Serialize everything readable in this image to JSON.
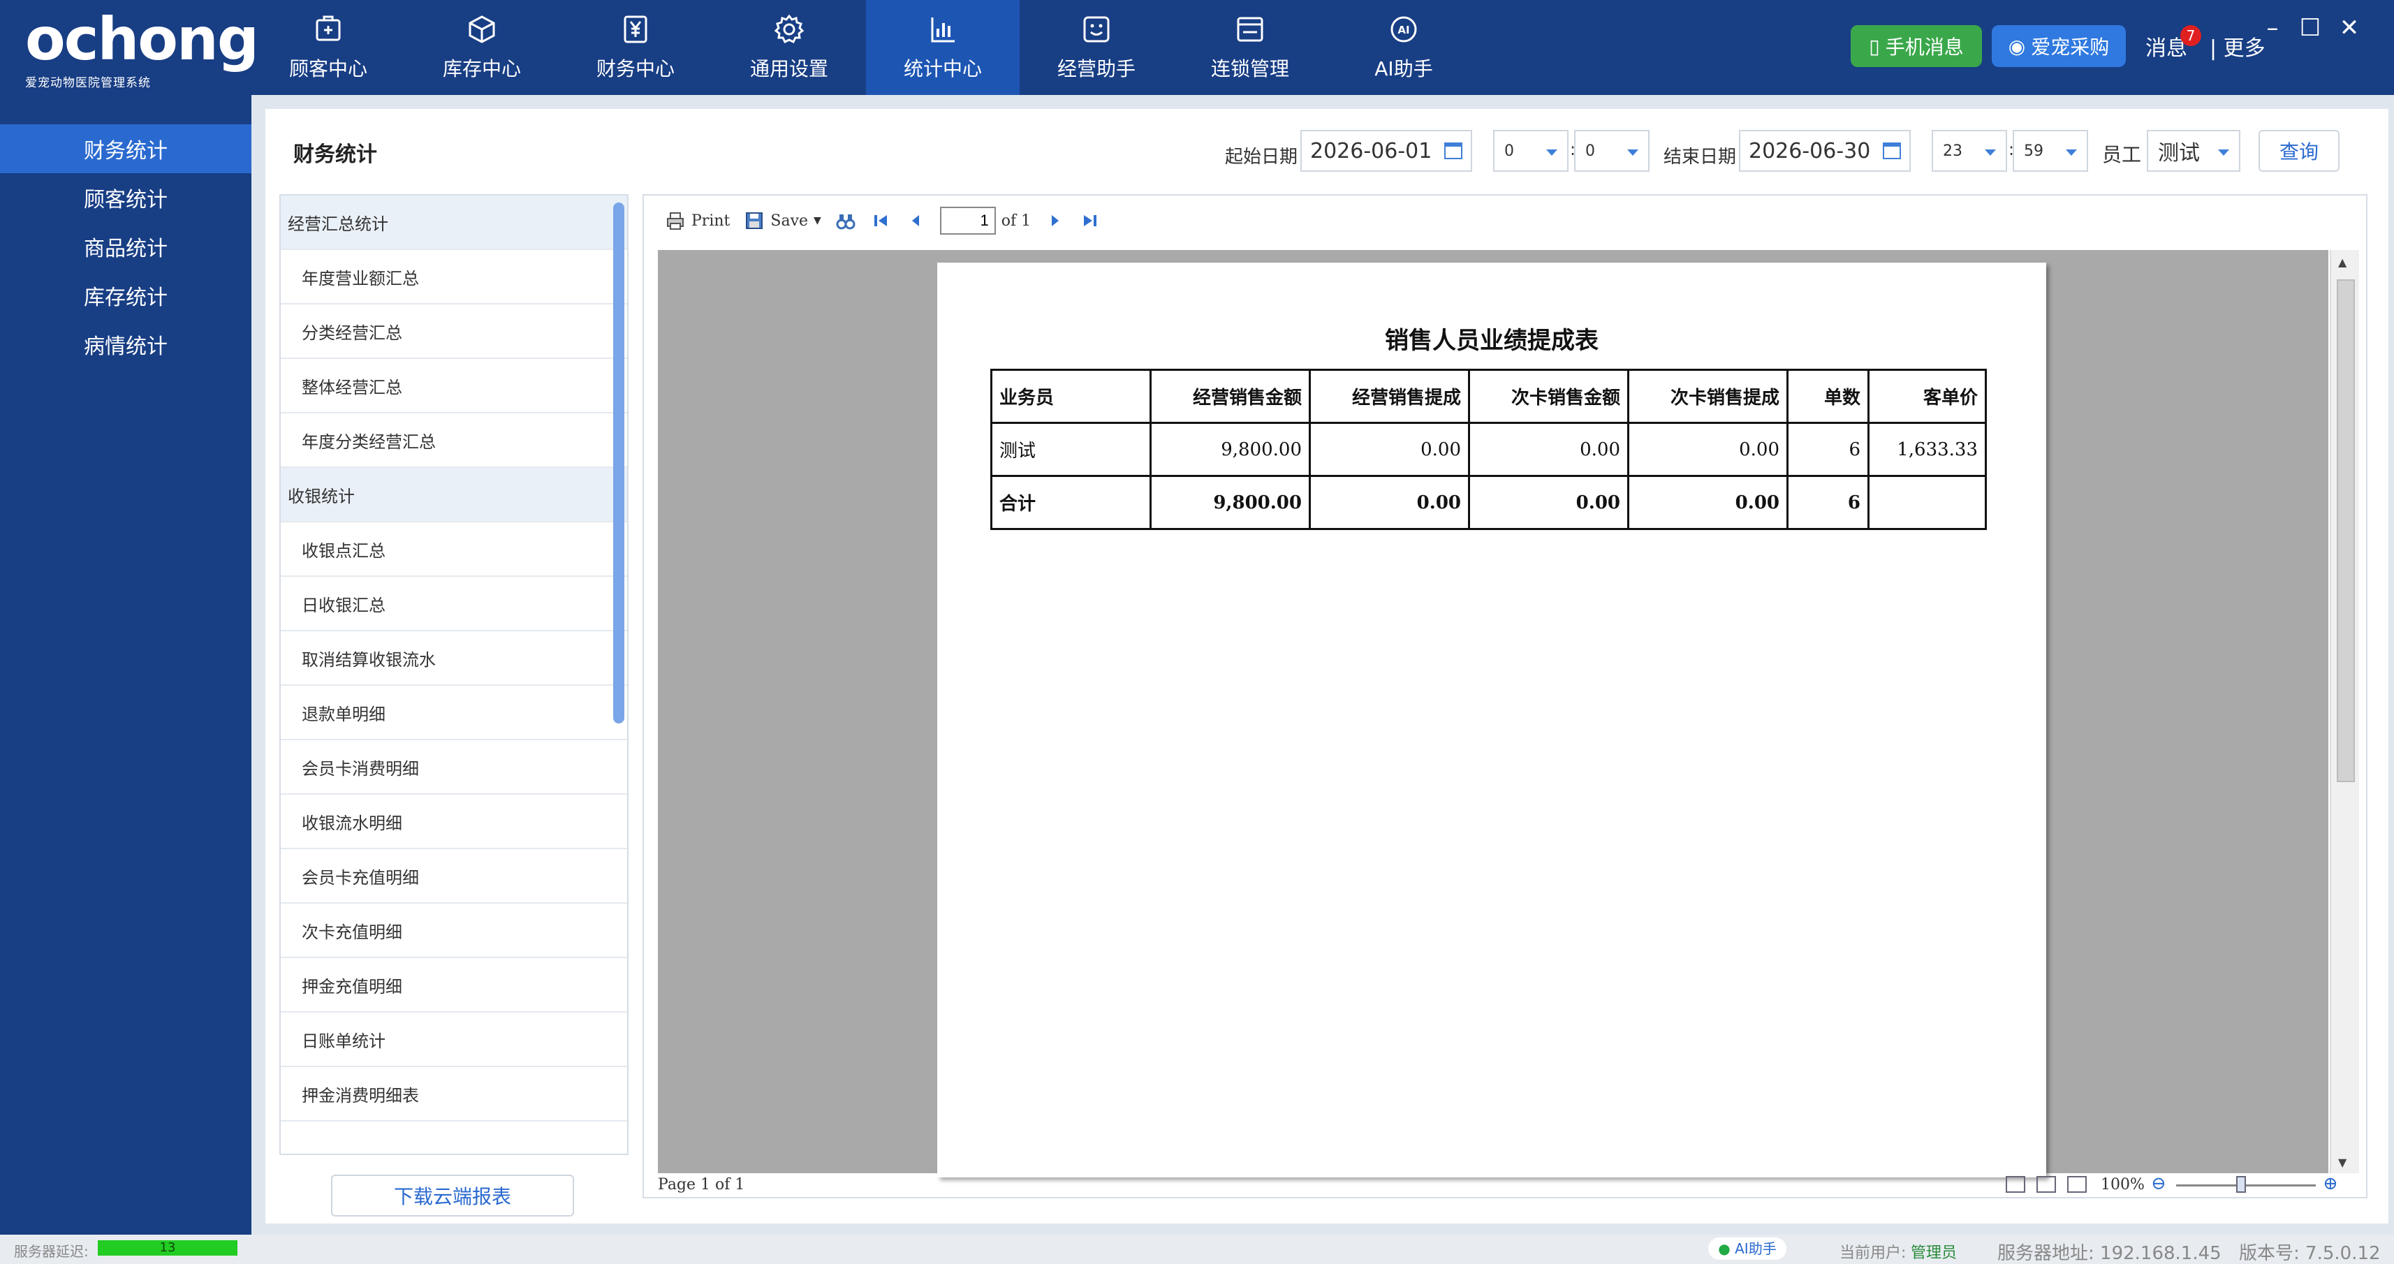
{
  "app": {
    "brand": "ochong",
    "tagline": "爱宠动物医院管理系统"
  },
  "nav": [
    {
      "label": "顾客中心",
      "icon": "customer-icon"
    },
    {
      "label": "库存中心",
      "icon": "box-icon"
    },
    {
      "label": "财务中心",
      "icon": "yen-icon"
    },
    {
      "label": "通用设置",
      "icon": "gear-icon"
    },
    {
      "label": "统计中心",
      "icon": "bar-chart-icon",
      "active": true
    },
    {
      "label": "经营助手",
      "icon": "smile-icon"
    },
    {
      "label": "连锁管理",
      "icon": "window-icon"
    },
    {
      "label": "AI助手",
      "icon": "ai-icon"
    }
  ],
  "top_right": {
    "mobile_msg": "手机消息",
    "purchase": "爱宠采购",
    "messages": "消息",
    "badge": "7",
    "more": "更多"
  },
  "sidebar": [
    {
      "label": "财务统计",
      "active": true
    },
    {
      "label": "顾客统计"
    },
    {
      "label": "商品统计"
    },
    {
      "label": "库存统计"
    },
    {
      "label": "病情统计"
    }
  ],
  "toolbar": {
    "title": "财务统计",
    "start_label": "起始日期",
    "start_date": "2026-06-01",
    "start_hour": "0",
    "start_min": "0",
    "end_label": "结束日期",
    "end_date": "2026-06-30",
    "end_hour": "23",
    "end_min": "59",
    "staff_label": "员工",
    "staff_value": "测试",
    "query": "查询"
  },
  "report_list": [
    {
      "label": "经营汇总统计",
      "group": true
    },
    {
      "label": "年度营业额汇总"
    },
    {
      "label": "分类经营汇总"
    },
    {
      "label": "整体经营汇总"
    },
    {
      "label": "年度分类经营汇总"
    },
    {
      "label": "收银统计",
      "group": true
    },
    {
      "label": "收银点汇总"
    },
    {
      "label": "日收银汇总"
    },
    {
      "label": "取消结算收银流水"
    },
    {
      "label": "退款单明细"
    },
    {
      "label": "会员卡消费明细"
    },
    {
      "label": "收银流水明细"
    },
    {
      "label": "会员卡充值明细"
    },
    {
      "label": "次卡充值明细"
    },
    {
      "label": "押金充值明细"
    },
    {
      "label": "日账单统计"
    },
    {
      "label": "押金消费明细表"
    }
  ],
  "download_btn": "下载云端报表",
  "viewer": {
    "print": "Print",
    "save": "Save",
    "page_current": "1",
    "page_of": "of 1",
    "status_page": "Page 1 of 1",
    "zoom": "100%"
  },
  "report": {
    "title": "销售人员业绩提成表",
    "headers": [
      "业务员",
      "经营销售金额",
      "经营销售提成",
      "次卡销售金额",
      "次卡销售提成",
      "单数",
      "客单价"
    ],
    "rows": [
      [
        "测试",
        "9,800.00",
        "0.00",
        "0.00",
        "0.00",
        "6",
        "1,633.33"
      ]
    ],
    "total": [
      "合计",
      "9,800.00",
      "0.00",
      "0.00",
      "0.00",
      "6",
      ""
    ]
  },
  "statusbar": {
    "latency_label": "服务器延迟:",
    "latency_value": "13",
    "ai": "AI助手",
    "user_label": "当前用户:",
    "user": "管理员",
    "server": "服务器地址: 192.168.1.45",
    "version": "版本号: 7.5.0.12"
  },
  "colors": {
    "nav_bg": "#183e84",
    "nav_active": "#1d55b3",
    "accent": "#2a6ad0",
    "green": "#3aa84a"
  }
}
